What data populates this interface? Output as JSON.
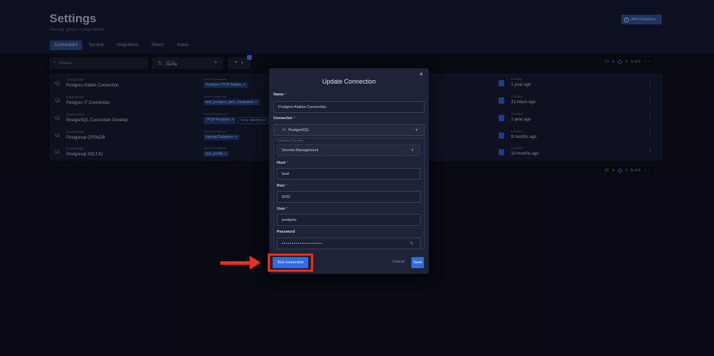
{
  "header": {
    "title": "Settings",
    "subtitle": "Manage global configurations",
    "add_button": "Add Datastore",
    "tabs": [
      "Connections",
      "Security",
      "Integrations",
      "Tokens",
      "Status"
    ]
  },
  "toolbar": {
    "search_placeholder": "Search",
    "sort_label": "Sort by",
    "sort_value": "Name",
    "filter_badge": "1",
    "pager_size": "12",
    "pager_range": "1 - 5 of 5"
  },
  "table": {
    "connection_label": "Connection",
    "sources_label": "Source Datastores",
    "created_label": "Created",
    "rows": [
      {
        "name": "Postgres Alation Connection",
        "chips": [
          "Postgres TPCH Alation ↗"
        ],
        "created": "1 year ago"
      },
      {
        "name": "Postgres IT Connection",
        "chips": [
          "test_postgres_tpch_integration ↗"
        ],
        "created": "21 hours ago"
      },
      {
        "name": "PostgreSQL Connection Develop",
        "chips": [
          "TPCH Postgres ↗",
          "to be deleted pe"
        ],
        "created": "1 year ago"
      },
      {
        "name": "Postgresql-CPSNDB",
        "chips": [
          "Internal Datastore ↗"
        ],
        "created": "9 months ago"
      },
      {
        "name": "Postgresql-XDLTJU",
        "chips": [
          "test_profile ↗"
        ],
        "created": "10 months ago"
      }
    ]
  },
  "modal": {
    "title": "Update Connection",
    "name_label": "Name",
    "name_value": "Postgres Alation Connection",
    "connector_label": "Connector",
    "connector_value": "PostgreSQL",
    "props_label": "Connector Properties",
    "secrets_value": "Secrets Management",
    "host_label": "Host",
    "host_value": "host",
    "port_label": "Port",
    "port_value": "5432",
    "user_label": "User",
    "user_value": "postgres",
    "password_label": "Password",
    "password_value": "••••••••••••••••••••",
    "test_button": "Test connection",
    "cancel_button": "Cancel",
    "save_button": "Save"
  },
  "colors": {
    "accent": "#2f6ce5",
    "highlight": "#e8311e",
    "background": "#0c0e1a"
  },
  "icons": [
    "plus-circle-icon",
    "search-icon",
    "sort-icon",
    "filter-icon",
    "database-icon",
    "calendar-icon",
    "kebab-icon",
    "close-icon",
    "pencil-icon",
    "chevron-down-icon"
  ]
}
